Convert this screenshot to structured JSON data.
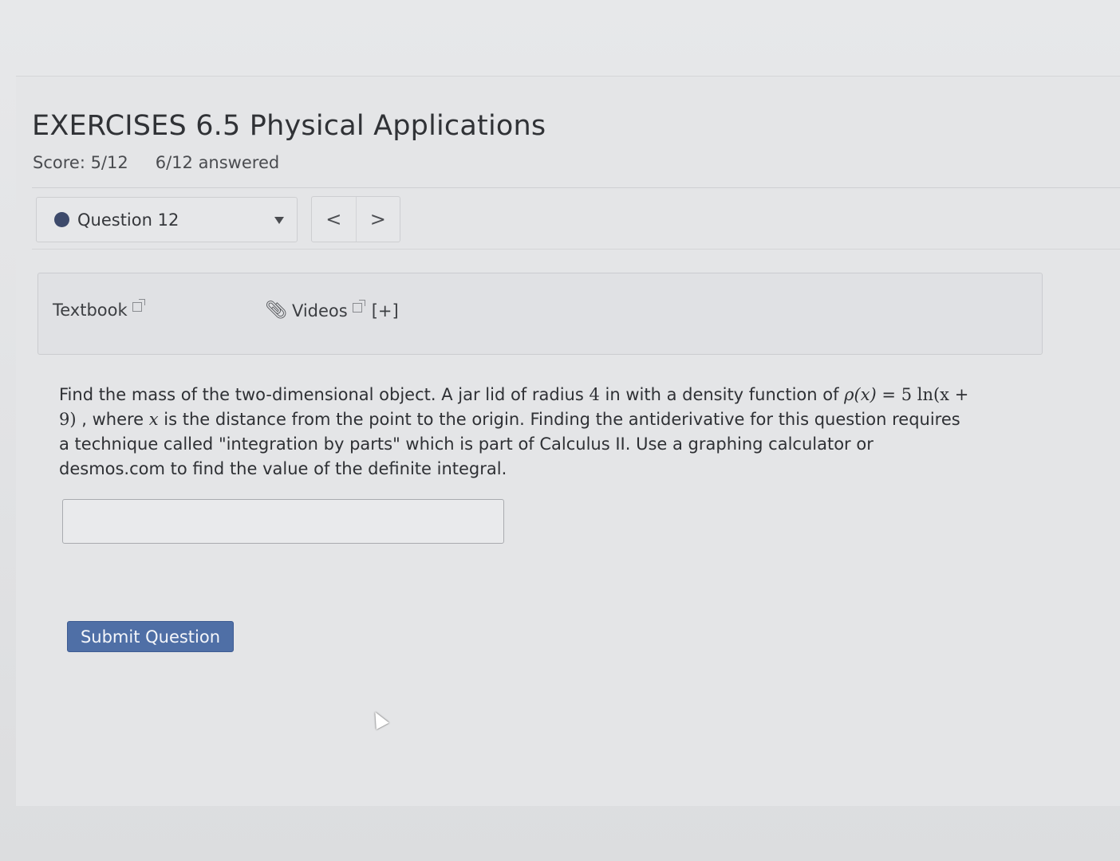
{
  "header": {
    "title": "EXERCISES 6.5 Physical Applications",
    "score": "Score: 5/12",
    "answered": "6/12 answered"
  },
  "question_nav": {
    "current": "Question 12",
    "prev": "<",
    "next": ">"
  },
  "help": {
    "textbook": "Textbook",
    "videos": "Videos",
    "expand": "[+]"
  },
  "question": {
    "text_1": "Find the mass of the two-dimensional object. A jar lid of radius ",
    "radius": "4",
    "text_2": " in with a density function of ",
    "rho_expr": "ρ(x)",
    "text_3": " = ",
    "density_expr": "5 ln(x + 9)",
    "text_4": " , where ",
    "var_x": "x",
    "text_5": " is the distance from the point to the origin. Finding the antiderivative for this question requires a technique called \"integration by parts\" which is part of Calculus II. Use a graphing calculator or desmos.com to find the value of the definite integral."
  },
  "answer": {
    "value": "",
    "placeholder": ""
  },
  "submit": {
    "label": "Submit Question"
  },
  "colors": {
    "submit_bg": "#4f6fa6",
    "status_dot": "#3d4a6b"
  }
}
